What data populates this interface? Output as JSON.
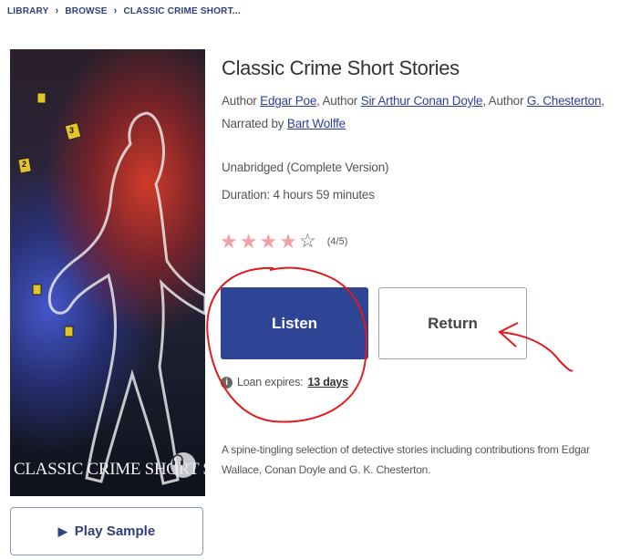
{
  "breadcrumb": {
    "items": [
      "LIBRARY",
      "BROWSE",
      "CLASSIC CRIME SHORT..."
    ],
    "separator": "›"
  },
  "book": {
    "title": "Classic Crime Short Stories",
    "author_prefix": "Author",
    "authors": [
      "Edgar Poe",
      "Sir Arthur Conan Doyle",
      "G. Chesterton"
    ],
    "narrator_prefix": "Narrated by",
    "narrator": "Bart Wolffe",
    "edition": "Unabridged (Complete Version)",
    "duration": "Duration: 4 hours 59 minutes",
    "rating_value": 4,
    "rating_max": 5,
    "rating_text": "(4/5)",
    "description": "A spine-tingling selection of detective stories including contributions from Edgar Wallace, Conan Doyle and G. K. Chesterton."
  },
  "cover": {
    "title_text": "CLASSIC CRIME SHORT STORIES",
    "marker_labels": [
      "3",
      "2"
    ],
    "headphone_icon": "headphones-icon"
  },
  "actions": {
    "listen_label": "Listen",
    "return_label": "Return",
    "play_sample_label": "Play Sample",
    "play_icon": "play-icon"
  },
  "loan": {
    "prefix": "Loan expires:",
    "days": "13 days",
    "info_icon": "info-icon"
  },
  "colors": {
    "brand_blue": "#2e4595",
    "link_blue": "#2f3f9e",
    "star": "#f2a0a3",
    "annotation_red": "#e21a1a"
  }
}
